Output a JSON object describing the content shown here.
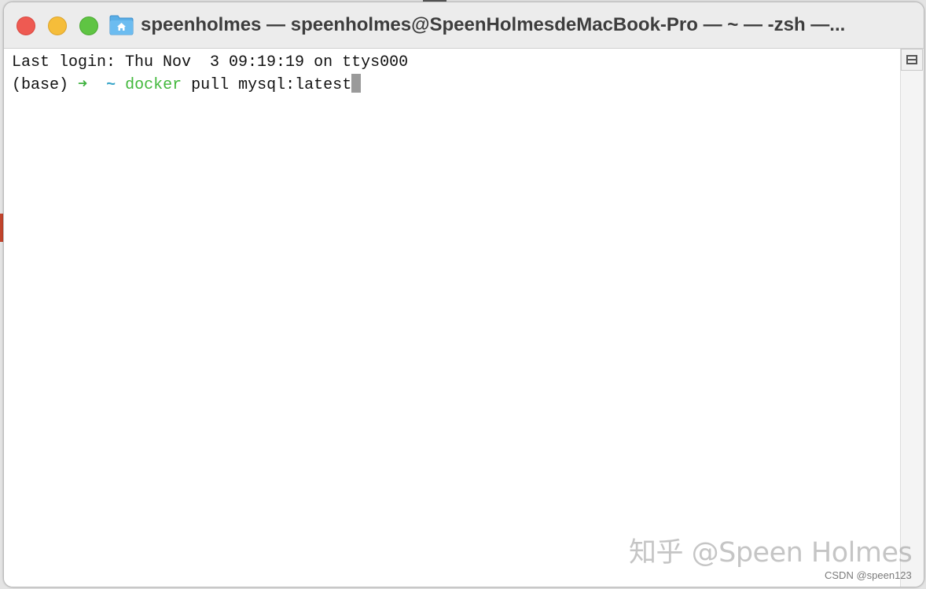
{
  "window": {
    "title": "speenholmes — speenholmes@SpeenHolmesdeMacBook-Pro — ~ — -zsh —...",
    "title_icon": "home-folder-icon"
  },
  "terminal": {
    "line1": "Last login: Thu Nov  3 09:19:19 on ttys000",
    "env": "(base)",
    "prompt_arrow": "➜",
    "cwd": "~",
    "command": "docker",
    "args": "pull mysql:latest"
  },
  "overlay": {
    "watermark": "知乎 @Speen Holmes",
    "credit": "CSDN @speen123"
  },
  "colors": {
    "close": "#ee5a52",
    "minimize": "#f5bd3a",
    "zoom": "#5fc443",
    "prompt_arrow": "#3fb23f",
    "cwd": "#3aa6c9",
    "command": "#42b83c"
  }
}
